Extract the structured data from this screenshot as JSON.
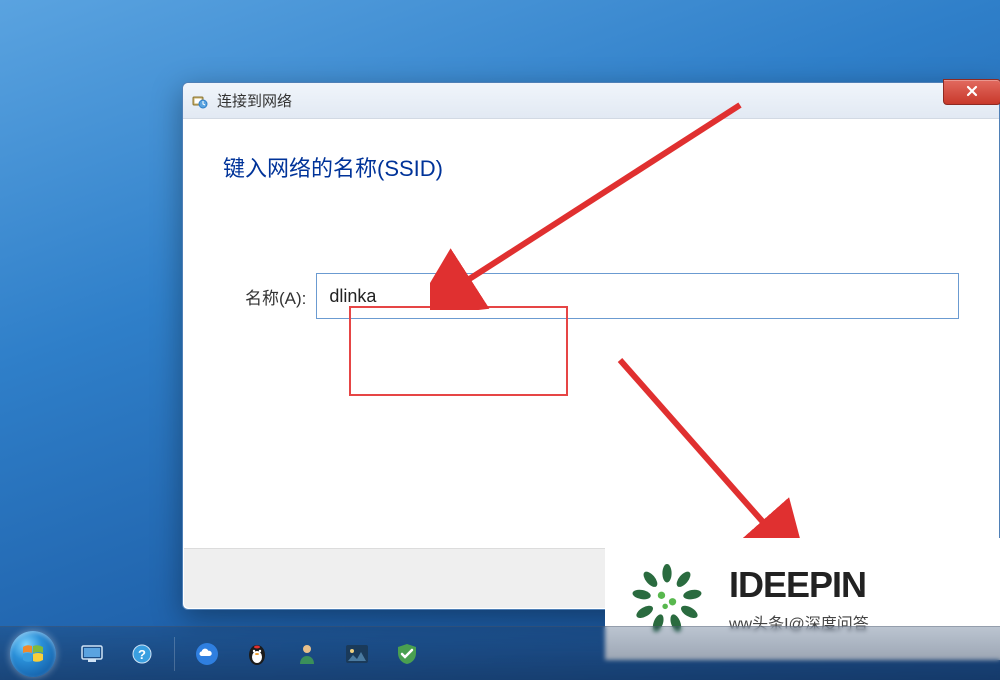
{
  "dialog": {
    "title": "连接到网络",
    "heading": "键入网络的名称(SSID)",
    "field_label": "名称(A):",
    "ssid_value": "dlinka"
  },
  "watermark": {
    "brand": "IDEEPIN",
    "sub": "ww头条I@深度问答"
  },
  "icons": {
    "network": "network-settings-icon",
    "close": "✕"
  },
  "colors": {
    "accent_blue": "#003399",
    "annotation_red": "#e64545",
    "desktop_bg": "#2f7fc9"
  }
}
